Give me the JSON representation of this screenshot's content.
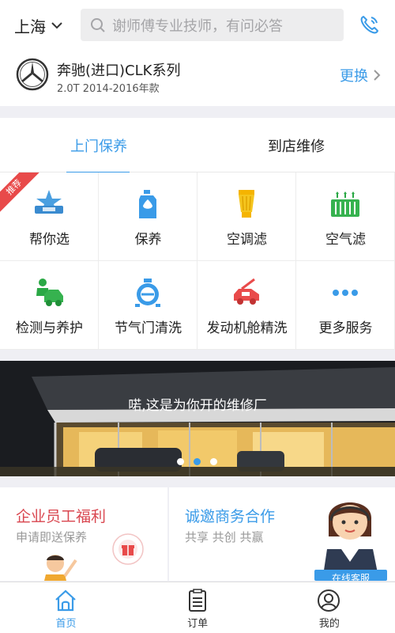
{
  "header": {
    "city": "上海",
    "search_placeholder": "谢师傅专业技师，有问必答"
  },
  "car": {
    "name": "奔驰(进口)CLK系列",
    "subtitle": "2.0T 2014-2016年款",
    "change_label": "更换"
  },
  "tabs": [
    {
      "label": "上门保养",
      "active": true
    },
    {
      "label": "到店维修",
      "active": false
    }
  ],
  "ribbon_label": "推荐",
  "services": [
    {
      "label": "帮你选",
      "icon": "star-badge-icon"
    },
    {
      "label": "保养",
      "icon": "oil-bottle-icon"
    },
    {
      "label": "空调滤",
      "icon": "ac-filter-icon"
    },
    {
      "label": "空气滤",
      "icon": "air-filter-icon"
    },
    {
      "label": "检测与养护",
      "icon": "car-inspection-icon"
    },
    {
      "label": "节气门清洗",
      "icon": "throttle-icon"
    },
    {
      "label": "发动机舱精洗",
      "icon": "engine-bay-icon"
    },
    {
      "label": "更多服务",
      "icon": "more-dots-icon"
    }
  ],
  "banner": {
    "text": "喏,这是为你开的维修厂",
    "slide_count": 3,
    "active_slide": 2
  },
  "promos": [
    {
      "title": "企业员工福利",
      "subtitle": "申请即送保养"
    },
    {
      "title": "诚邀商务合作",
      "subtitle": "共享 共创 共赢",
      "badge": "在线客服"
    }
  ],
  "nav": [
    {
      "label": "首页",
      "icon": "home-icon",
      "active": true
    },
    {
      "label": "订单",
      "icon": "order-icon",
      "active": false
    },
    {
      "label": "我的",
      "icon": "profile-icon",
      "active": false
    }
  ],
  "colors": {
    "accent": "#3a9be8",
    "promo_red": "#d9464f",
    "ribbon_red": "#e84a4a"
  }
}
